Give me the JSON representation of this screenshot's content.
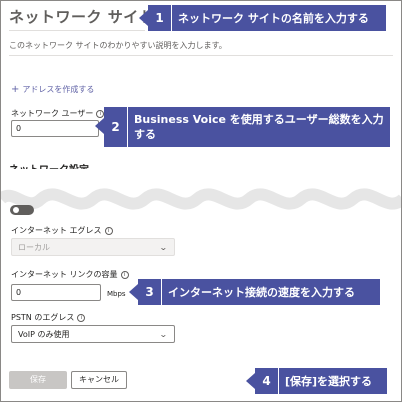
{
  "site": {
    "title": "ネットワーク サイト名",
    "description": "このネットワーク サイトのわかりやすい説明を入力します。",
    "add_address_label": "アドレスを作成する"
  },
  "fields": {
    "network_users_label": "ネットワーク ユーザー",
    "network_users_value": "0",
    "network_settings_heading": "ネットワーク設定",
    "internet_egress_label": "インターネット エグレス",
    "internet_egress_value": "ローカル",
    "internet_capacity_label": "インターネット リンクの容量",
    "internet_capacity_value": "0",
    "internet_capacity_unit": "Mbps",
    "pstn_egress_label": "PSTN のエグレス",
    "pstn_egress_value": "VoIP のみ使用"
  },
  "buttons": {
    "save_label": "保存",
    "cancel_label": "キャンセル"
  },
  "callouts": [
    {
      "number": "1",
      "text": "ネットワーク サイトの名前を入力する"
    },
    {
      "number": "2",
      "text": "Business Voice を使用するユーザー総数を入力する"
    },
    {
      "number": "3",
      "text": "インターネット接続の速度を入力する"
    },
    {
      "number": "4",
      "text": "[保存]を選択する"
    }
  ],
  "colors": {
    "callout_bg": "#4a52a0",
    "accent": "#6264a7"
  },
  "icons": [
    "info-icon",
    "chevron-down-icon",
    "plus-icon"
  ]
}
